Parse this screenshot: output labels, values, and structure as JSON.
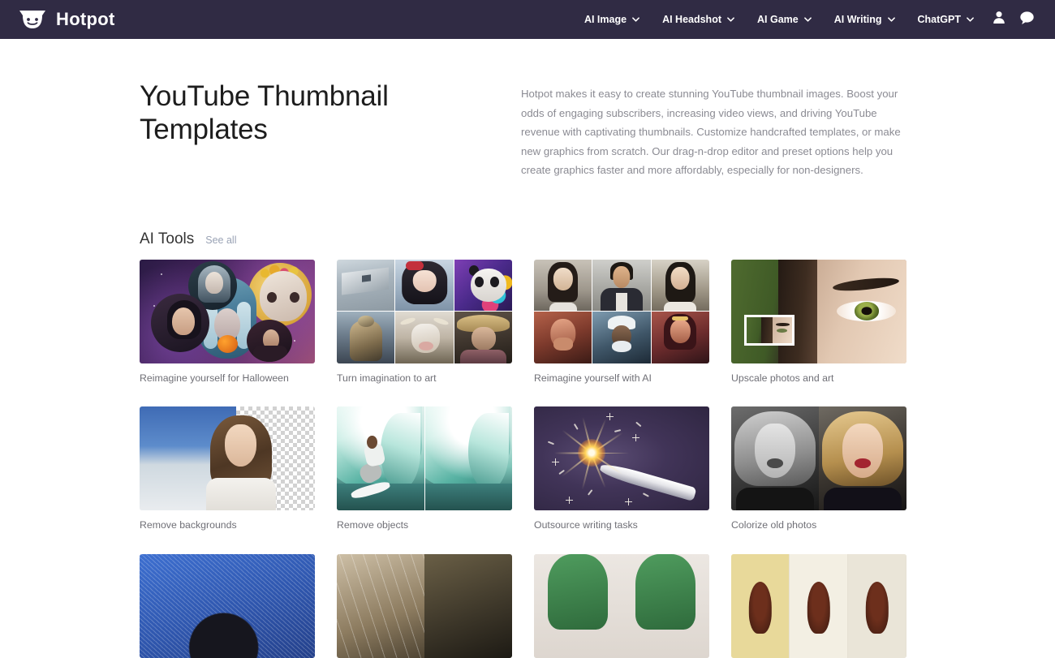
{
  "header": {
    "brand": "Hotpot",
    "logo_icon": "hotpot-smiley-logo",
    "nav_items": [
      {
        "label": "AI Image",
        "icon": "chevron-down-icon"
      },
      {
        "label": "AI Headshot",
        "icon": "chevron-down-icon"
      },
      {
        "label": "AI Game",
        "icon": "chevron-down-icon"
      },
      {
        "label": "AI Writing",
        "icon": "chevron-down-icon"
      },
      {
        "label": "ChatGPT",
        "icon": "chevron-down-icon"
      }
    ],
    "account_icon": "user-account-icon",
    "chat_icon": "chat-bubble-icon",
    "background_color": "#302b44"
  },
  "hero": {
    "title": "YouTube Thumbnail Templates",
    "description": "Hotpot makes it easy to create stunning YouTube thumbnail images. Boost your odds of engaging subscribers, increasing video views, and driving YouTube revenue with captivating thumbnails. Customize handcrafted templates, or make new graphics from scratch. Our drag-n-drop editor and preset options help you create graphics faster and more affordably, especially for non-designers."
  },
  "section": {
    "title": "AI Tools",
    "see_all_label": "See all",
    "see_all_color": "#9aa3b5"
  },
  "cards": [
    {
      "caption": "Reimagine yourself for Halloween",
      "art": "halloween-collage"
    },
    {
      "caption": "Turn imagination to art",
      "art": "ai-art-grid"
    },
    {
      "caption": "Reimagine yourself with AI",
      "art": "headshot-grid"
    },
    {
      "caption": "Upscale photos and art",
      "art": "eye-closeup-upscale"
    },
    {
      "caption": "Remove backgrounds",
      "art": "background-removal-checker"
    },
    {
      "caption": "Remove objects",
      "art": "surfer-object-removal"
    },
    {
      "caption": "Outsource writing tasks",
      "art": "pen-sparkler"
    },
    {
      "caption": "Colorize old photos",
      "art": "bw-to-color-portrait"
    }
  ],
  "cards_row3": [
    {
      "art": "blue-sketch-portrait"
    },
    {
      "art": "sepia-restore"
    },
    {
      "art": "green-hair-portrait"
    },
    {
      "art": "butterfly-specimens"
    }
  ]
}
